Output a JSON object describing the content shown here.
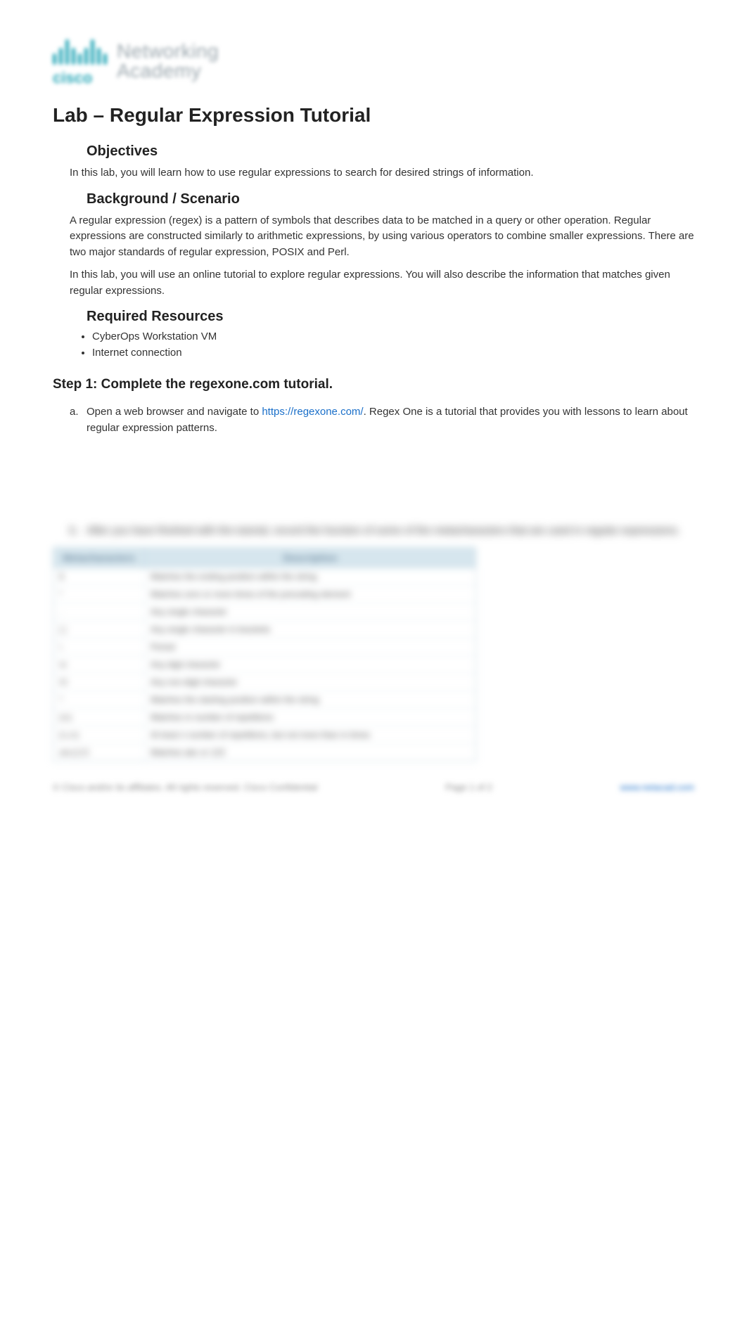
{
  "logo": {
    "word": "cisco",
    "line1": "Networking",
    "line2": "Academy"
  },
  "title": "Lab – Regular Expression Tutorial",
  "objectives": {
    "heading": "Objectives",
    "text": "In this lab, you will learn how to use regular expressions to search for desired strings of information."
  },
  "background": {
    "heading": "Background / Scenario",
    "p1": "A regular expression (regex) is a pattern of symbols that describes data to be matched in a query or other operation. Regular expressions are constructed similarly to arithmetic expressions, by using various operators to combine smaller expressions. There are two major standards of regular expression, POSIX and Perl.",
    "p2": "In this lab, you will use an online tutorial to explore regular expressions. You will also describe the information that matches given regular expressions."
  },
  "resources": {
    "heading": "Required Resources",
    "items": [
      "CyberOps Workstation VM",
      "Internet connection"
    ]
  },
  "step1": {
    "heading": "Step 1: Complete the regexone.com tutorial.",
    "a_prefix": "Open a web browser and navigate to ",
    "a_link_text": "https://regexone.com/",
    "a_suffix": ". Regex One is a tutorial that provides you with lessons to learn about regular expression patterns.",
    "b_text": "After you have finished with the tutorial, record the function of some of the metacharacters that are used in regular expressions."
  },
  "table": {
    "header1": "Metacharacters",
    "header2": "Description",
    "rows": [
      {
        "c1": "$",
        "c2": "Matches the ending position within the string"
      },
      {
        "c1": "*",
        "c2": "Matches zero or more times of the preceding element"
      },
      {
        "c1": ".",
        "c2": "Any single character"
      },
      {
        "c1": "[ ]",
        "c2": "Any single character in brackets"
      },
      {
        "c1": "\\.",
        "c2": "Period"
      },
      {
        "c1": "\\d",
        "c2": "Any digit character"
      },
      {
        "c1": "\\D",
        "c2": "Any non-digit character"
      },
      {
        "c1": "^",
        "c2": "Matches the starting position within the string"
      },
      {
        "c1": "{m}",
        "c2": "Matches m number of repetitions"
      },
      {
        "c1": "{n,m}",
        "c2": "At least n number of repetitions, but not more than m times"
      },
      {
        "c1": "abc|123",
        "c2": "Matches abc or 123"
      }
    ]
  },
  "footer": {
    "left": "© Cisco and/or its affiliates. All rights reserved. Cisco Confidential",
    "center": "Page 1 of 2",
    "right": "www.netacad.com"
  }
}
